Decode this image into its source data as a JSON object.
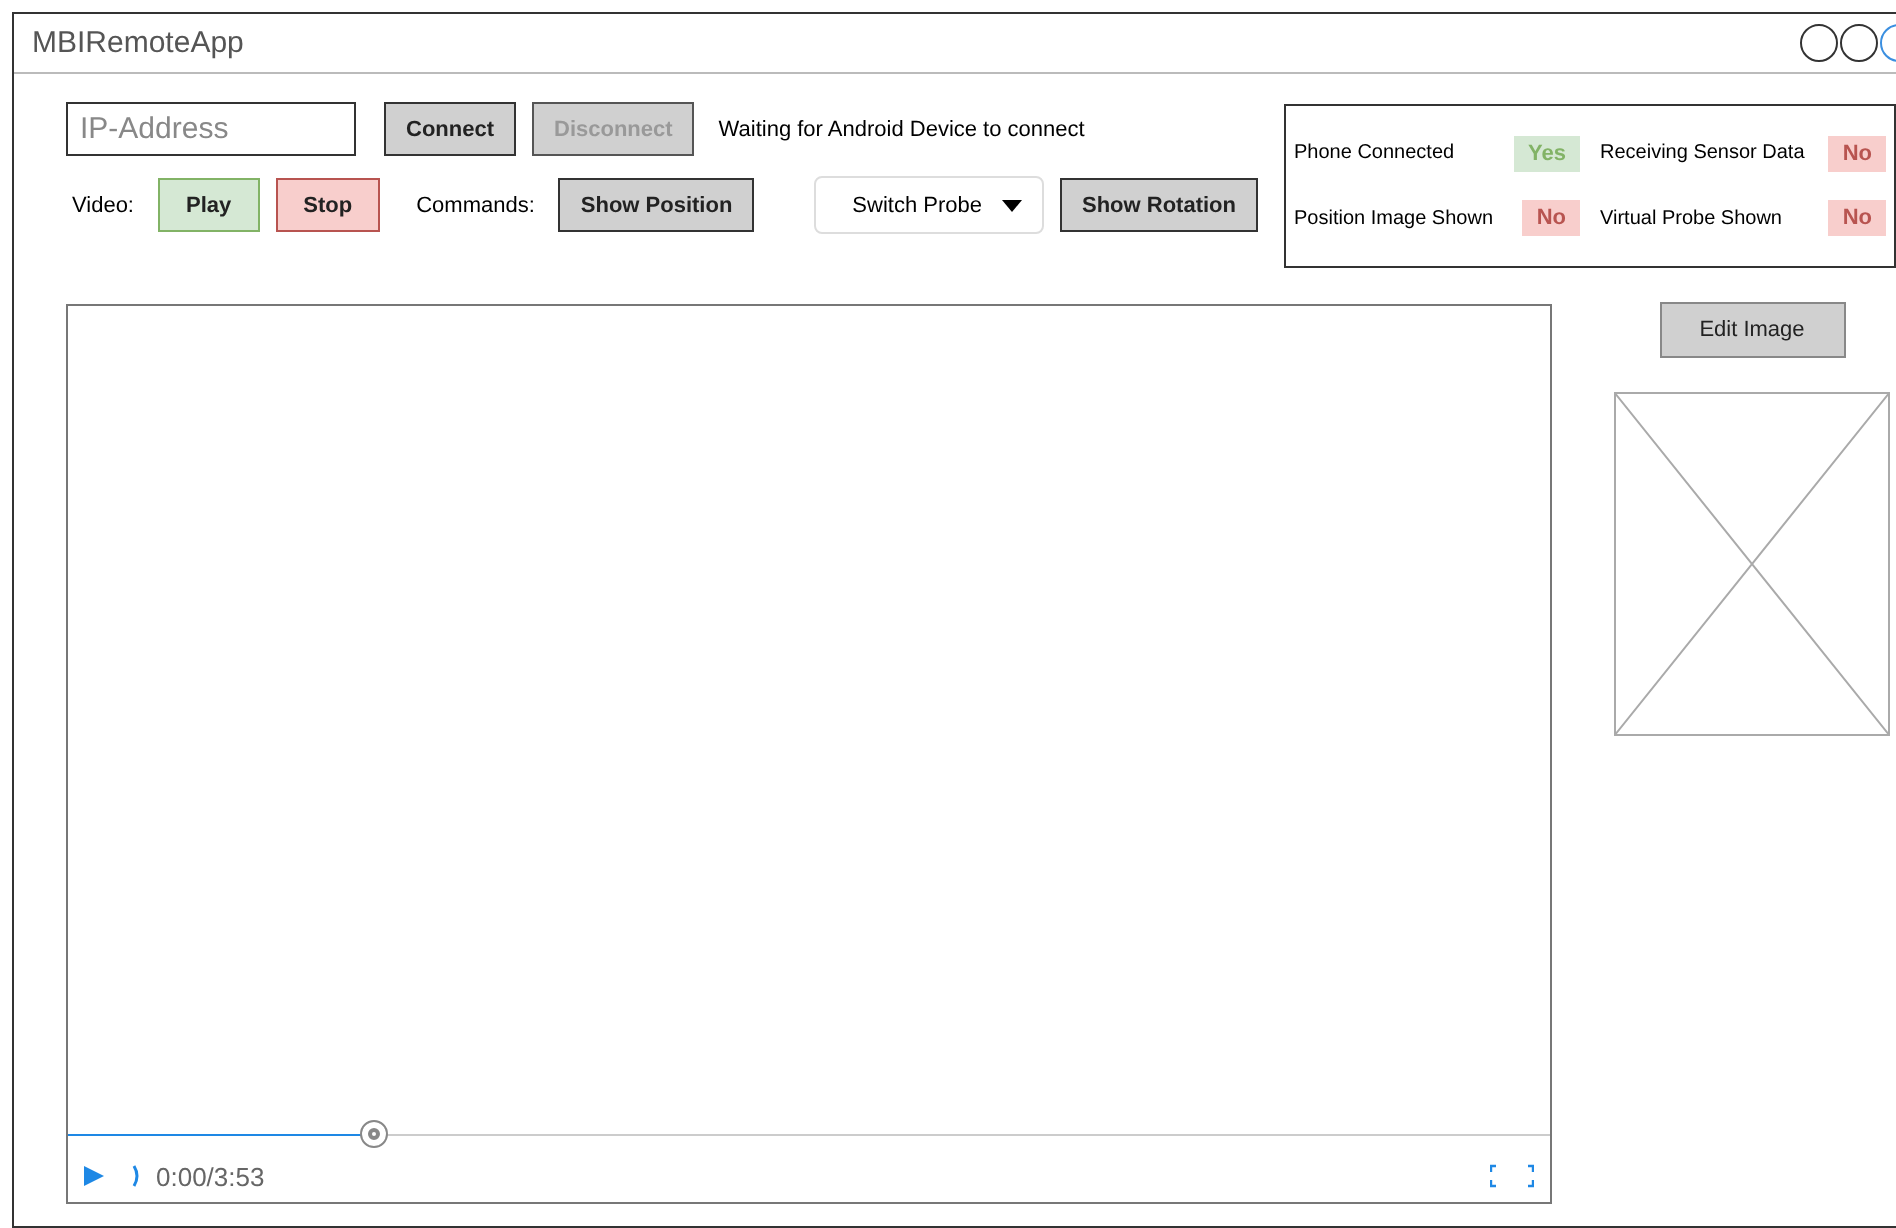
{
  "window": {
    "title": "MBIRemoteApp"
  },
  "connection": {
    "ip_placeholder": "IP-Address",
    "buttons": [
      {
        "label": "Connect",
        "disabled": false
      },
      {
        "label": "Disconnect",
        "disabled": true
      }
    ],
    "status_text": "Waiting for Android Device to connect"
  },
  "controls": [
    {
      "kind": "label",
      "text": "Video:"
    },
    {
      "kind": "green",
      "text": "Play"
    },
    {
      "kind": "red",
      "text": "Stop"
    },
    {
      "kind": "label",
      "text": "Commands:"
    },
    {
      "kind": "grey",
      "text": "Show Position"
    },
    {
      "kind": "dropdown",
      "text": "Switch Probe"
    },
    {
      "kind": "grey",
      "text": "Show Rotation"
    }
  ],
  "status_panel": [
    {
      "label": "Phone Connected",
      "value": "Yes",
      "on": true
    },
    {
      "label": "Receiving Sensor Data",
      "value": "No",
      "on": false
    },
    {
      "label": "Position Image Shown",
      "value": "No",
      "on": false
    },
    {
      "label": "Virtual Probe Shown",
      "value": "No",
      "on": false
    }
  ],
  "video_player": {
    "level": 0.206,
    "time": "0:00/3:53"
  },
  "side": {
    "edit_button": "Edit Image"
  }
}
